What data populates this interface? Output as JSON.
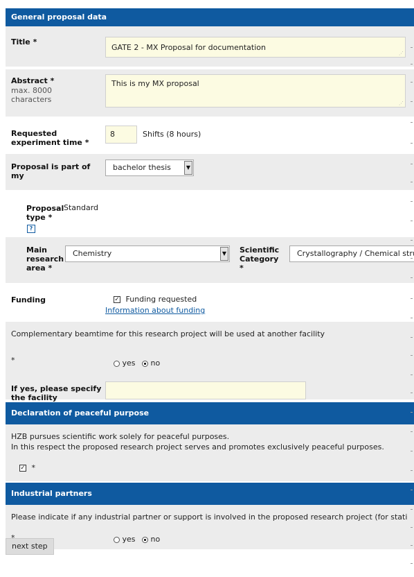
{
  "general": {
    "header": "General proposal data"
  },
  "title_field": {
    "label": "Title *",
    "value": "GATE 2 - MX Proposal for documentation"
  },
  "abstract_field": {
    "label": "Abstract *",
    "sublabel": "max. 8000 characters",
    "value": "This is my MX proposal"
  },
  "experiment_time": {
    "label": "Requested experiment time *",
    "value": "8",
    "unit": "Shifts (8 hours)"
  },
  "part_of": {
    "label": "Proposal is part of my",
    "selected": "bachelor thesis"
  },
  "proposal_type": {
    "label": "Proposal type *",
    "value": "Standard",
    "help": "?"
  },
  "research_area": {
    "label": "Main research area *",
    "selected": "Chemistry"
  },
  "scientific_category": {
    "label": "Scientific Category *",
    "selected": "Crystallography / Chemical struc"
  },
  "funding": {
    "label": "Funding",
    "checkbox_label": "Funding requested",
    "checked": true,
    "link": "Information about funding"
  },
  "complementary": {
    "question": "Complementary beamtime for this research project will be used at another facility",
    "required_mark": "*",
    "yes": "yes",
    "no": "no",
    "selected": "no"
  },
  "facility": {
    "label": "If yes, please specify the facility",
    "value": ""
  },
  "peaceful": {
    "header": "Declaration of peaceful purpose",
    "line1": "HZB pursues scientific work solely for peaceful purposes.",
    "line2": "In this respect the proposed research project serves and promotes exclusively peaceful purposes.",
    "required_mark": "*",
    "checked": true
  },
  "industrial": {
    "header": "Industrial partners",
    "question": "Please indicate if any industrial partner or support is involved in the proposed research project (for stati",
    "required_mark": "*",
    "yes": "yes",
    "no": "no",
    "selected": "no"
  },
  "next_button": "next step",
  "colors": {
    "header_bg": "#0f5aa0",
    "field_bg": "#fcfbe2",
    "row_grey": "#ececec"
  }
}
